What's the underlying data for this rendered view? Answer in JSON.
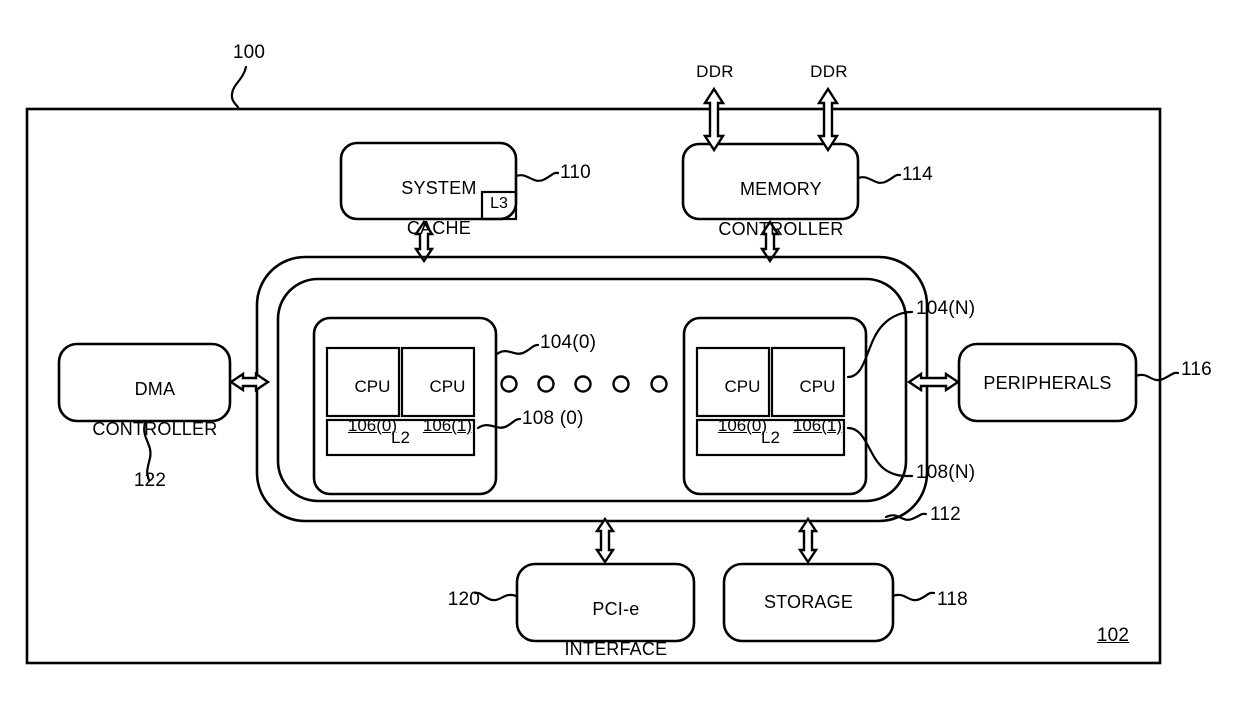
{
  "figure": {
    "top_ref": "100",
    "chip_ref": "102"
  },
  "blocks": {
    "system_cache": {
      "line1": "SYSTEM",
      "line2": "CACHE",
      "sub_label": "L3",
      "ref": "110"
    },
    "memory_controller": {
      "line1": "MEMORY",
      "line2": "CONTROLLER",
      "ref": "114"
    },
    "dma_controller": {
      "line1": "DMA",
      "line2": "CONTROLLER",
      "ref": "122"
    },
    "peripherals": {
      "label": "PERIPHERALS",
      "ref": "116"
    },
    "pcie_interface": {
      "line1": "PCI-e",
      "line2": "INTERFACE",
      "ref": "120"
    },
    "storage": {
      "label": "STORAGE",
      "ref": "118"
    },
    "interconnect": {
      "ref": "112"
    }
  },
  "ddr_ports": [
    {
      "label": "DDR"
    },
    {
      "label": "DDR"
    }
  ],
  "clusters": [
    {
      "ref": "104(0)",
      "cache_ref": "108 (0)",
      "cache_label": "L2",
      "cpus": [
        {
          "name": "CPU",
          "index": "106(0)"
        },
        {
          "name": "CPU",
          "index": "106(1)"
        }
      ]
    },
    {
      "ref": "104(N)",
      "cache_ref": "108(N)",
      "cache_label": "L2",
      "cpus": [
        {
          "name": "CPU",
          "index": "106(0)"
        },
        {
          "name": "CPU",
          "index": "106(1)"
        }
      ]
    }
  ],
  "ellipsis": {
    "dot_count": 5
  },
  "colors": {
    "stroke": "#000000",
    "background": "#ffffff"
  }
}
